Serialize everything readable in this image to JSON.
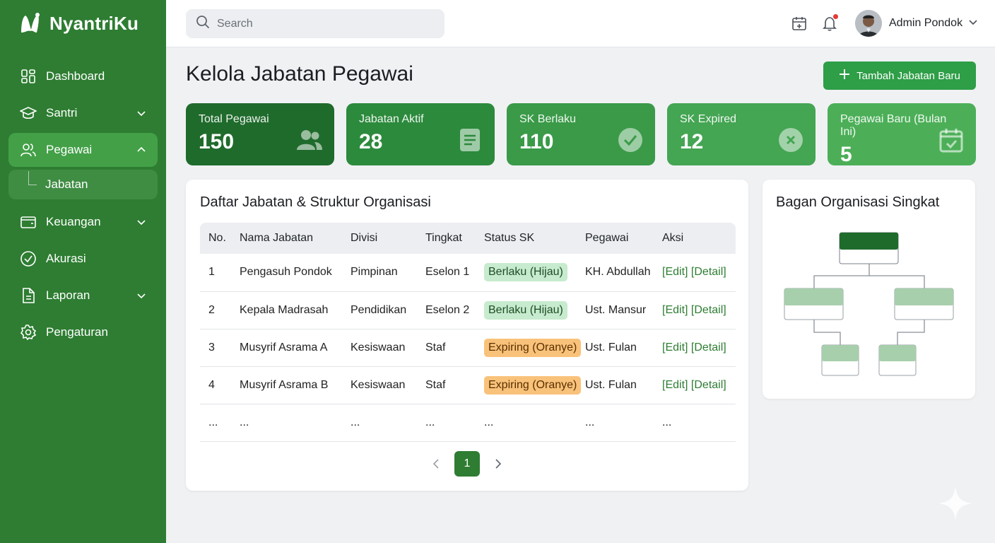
{
  "brand": {
    "name": "NyantriKu"
  },
  "colors": {
    "sidebar": "#2e7d32",
    "primary_button": "#2e9e47",
    "badge_green": "#c7ebce",
    "badge_orange": "#f9c27a"
  },
  "sidebar": {
    "items": [
      {
        "label": "Dashboard",
        "icon": "dashboard-icon"
      },
      {
        "label": "Santri",
        "icon": "graduation-cap-icon",
        "expandable": true
      },
      {
        "label": "Pegawai",
        "icon": "users-icon",
        "expandable": true,
        "expanded": true,
        "active": true
      },
      {
        "label": "Keuangan",
        "icon": "wallet-icon",
        "expandable": true
      },
      {
        "label": "Akurasi",
        "icon": "check-circle-icon"
      },
      {
        "label": "Laporan",
        "icon": "document-icon",
        "expandable": true
      },
      {
        "label": "Pengaturan",
        "icon": "gear-icon"
      }
    ],
    "sub_item": {
      "label": "Jabatan"
    }
  },
  "topbar": {
    "search_placeholder": "Search",
    "user_name": "Admin Pondok"
  },
  "page": {
    "title": "Kelola Jabatan Pegawai",
    "add_button": "Tambah Jabatan Baru"
  },
  "stats": [
    {
      "label": "Total Pegawai",
      "value": "150",
      "icon": "users-icon",
      "color": "#1f6b2c"
    },
    {
      "label": "Jabatan Aktif",
      "value": "28",
      "icon": "clipboard-icon",
      "color": "#2c8a3c"
    },
    {
      "label": "SK Berlaku",
      "value": "110",
      "icon": "check-circle-icon",
      "color": "#3a9a48"
    },
    {
      "label": "SK Expired",
      "value": "12",
      "icon": "x-circle-icon",
      "color": "#44a553"
    },
    {
      "label": "Pegawai Baru (Bulan Ini)",
      "value": "5",
      "icon": "calendar-check-icon",
      "color": "#4caf58"
    }
  ],
  "table": {
    "title": "Daftar Jabatan & Struktur Organisasi",
    "columns": [
      "No.",
      "Nama Jabatan",
      "Divisi",
      "Tingkat",
      "Status SK",
      "Pegawai",
      "Aksi"
    ],
    "rows": [
      {
        "no": "1",
        "nama": "Pengasuh Pondok",
        "divisi": "Pimpinan",
        "tingkat": "Eselon 1",
        "status": "Berlaku (Hijau)",
        "status_type": "green",
        "pegawai": "KH. Abdullah",
        "edit": "[Edit]",
        "detail": "[Detail]"
      },
      {
        "no": "2",
        "nama": "Kepala Madrasah",
        "divisi": "Pendidikan",
        "tingkat": "Eselon 2",
        "status": "Berlaku (Hijau)",
        "status_type": "green",
        "pegawai": "Ust. Mansur",
        "edit": "[Edit]",
        "detail": "[Detail]"
      },
      {
        "no": "3",
        "nama": "Musyrif Asrama A",
        "divisi": "Kesiswaan",
        "tingkat": "Staf",
        "status": "Expiring (Oranye)",
        "status_type": "orange",
        "pegawai": "Ust. Fulan",
        "edit": "[Edit]",
        "detail": "[Detail]"
      },
      {
        "no": "4",
        "nama": "Musyrif Asrama B",
        "divisi": "Kesiswaan",
        "tingkat": "Staf",
        "status": "Expiring (Oranye)",
        "status_type": "orange",
        "pegawai": "Ust. Fulan",
        "edit": "[Edit]",
        "detail": "[Detail]"
      },
      {
        "no": "...",
        "nama": "...",
        "divisi": "...",
        "tingkat": "...",
        "status": "...",
        "status_type": "none",
        "pegawai": "...",
        "edit": "...",
        "detail": ""
      }
    ],
    "pagination": {
      "current": "1"
    }
  },
  "org_chart": {
    "title": "Bagan Organisasi Singkat"
  }
}
